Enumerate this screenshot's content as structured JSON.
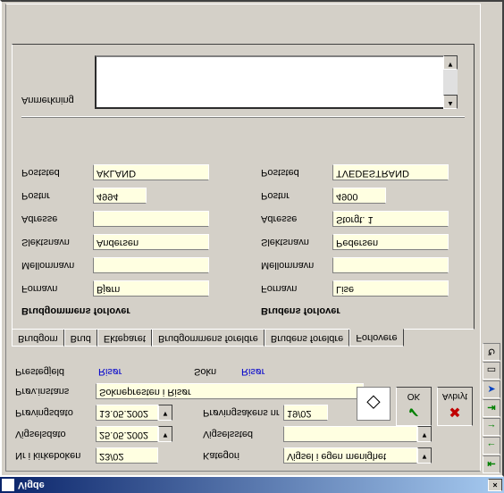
{
  "window": {
    "title": "Vigde",
    "close": "×"
  },
  "top": {
    "nr_label": "Nr i kirkeboken",
    "nr_value": "23/02",
    "kategori_label": "Kategori",
    "kategori_value": "Vigsel i egen menighet",
    "vigselsdato_label": "Vigselsdato",
    "vigselsdato_value": "25.05.2002",
    "vigselssted_label": "Vigselssted",
    "vigselssted_value": "",
    "provingsdato_label": "Prøvingsdato",
    "provingsdato_value": "13.05.2002",
    "provingsakens_label": "Prøvingsakens nr",
    "provingsakens_value": "19/02",
    "provinstans_label": "Prøv.instans",
    "provinstans_value": "Soknepresten i Risør",
    "prestegjeld_label": "Prestegjeld",
    "prestegjeld_value": "Risør",
    "sokn_label": "Sokn",
    "sokn_value": "Risør"
  },
  "buttons": {
    "ok": "OK",
    "avbryt": "Avbryt"
  },
  "tabs": {
    "t1": "Brudgom",
    "t2": "Brud",
    "t3": "Ekteparet",
    "t4": "Brudgommens foreldre",
    "t5": "Brudens foreldre",
    "t6": "Forlovere"
  },
  "forlovere": {
    "brudgom_heading": "Brudgommens forlover",
    "brud_heading": "Brudens forlover",
    "fornavn_label": "Fornavn",
    "mellomnavn_label": "Mellomnavn",
    "slektsnavn_label": "Slektsnavn",
    "adresse_label": "Adresse",
    "postnr_label": "Postnr",
    "poststed_label": "Poststed",
    "g": {
      "fornavn": "Bjørn",
      "mellomnavn": "",
      "slektsnavn": "Andersen",
      "adresse": "",
      "postnr": "4994",
      "poststed": "AKLAND"
    },
    "b": {
      "fornavn": "Lise",
      "mellomnavn": "",
      "slektsnavn": "Pedersen",
      "adresse": "Storgt. 1",
      "postnr": "4900",
      "poststed": "TVEDESTRAND"
    }
  },
  "remark": {
    "label": "Anmerkning"
  }
}
